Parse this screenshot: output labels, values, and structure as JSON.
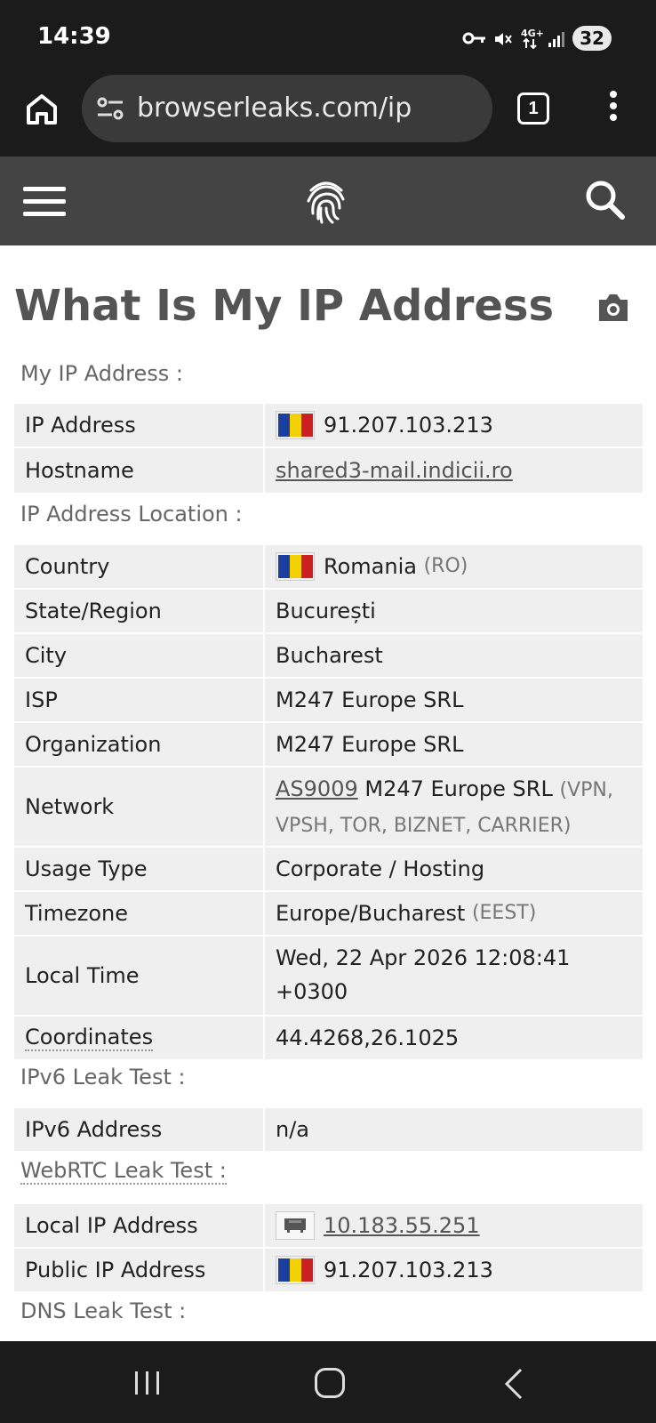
{
  "status_bar": {
    "time": "14:39",
    "battery": "32",
    "icons": [
      "vpn-key-icon",
      "mute-icon",
      "4g-icon",
      "signal-icon"
    ]
  },
  "browser": {
    "url": "browserleaks.com/ip",
    "tab_count": "1"
  },
  "page": {
    "title": "What Is My IP Address"
  },
  "sections": {
    "my_ip": {
      "label": "My IP Address :",
      "ip_key": "IP Address",
      "ip_value": "91.207.103.213",
      "host_key": "Hostname",
      "host_value": "shared3-mail.indicii.ro"
    },
    "location": {
      "label": "IP Address Location :",
      "country_key": "Country",
      "country_value": "Romania",
      "country_code": "(RO)",
      "state_key": "State/Region",
      "state_value": "București",
      "city_key": "City",
      "city_value": "Bucharest",
      "isp_key": "ISP",
      "isp_value": "M247 Europe SRL",
      "org_key": "Organization",
      "org_value": "M247 Europe SRL",
      "network_key": "Network",
      "network_asn": "AS9009",
      "network_name": "M247 Europe SRL",
      "network_tags_1": "(VPN,",
      "network_tags_2": "VPSH, TOR, BIZNET, CARRIER)",
      "usage_key": "Usage Type",
      "usage_value": "Corporate / Hosting",
      "tz_key": "Timezone",
      "tz_value": "Europe/Bucharest",
      "tz_abbr": "(EEST)",
      "time_key": "Local Time",
      "time_value_1": "Wed, 22 Apr 2026 12:08:41",
      "time_value_2": "+0300",
      "coords_key": "Coordinates",
      "coords_value": "44.4268,26.1025"
    },
    "ipv6": {
      "label": "IPv6 Leak Test :",
      "key": "IPv6 Address",
      "value": "n/a"
    },
    "webrtc": {
      "label": "WebRTC Leak Test :",
      "local_key": "Local IP Address",
      "local_value": "10.183.55.251",
      "public_key": "Public IP Address",
      "public_value": "91.207.103.213"
    },
    "dns": {
      "label": "DNS Leak Test :"
    }
  },
  "colors": {
    "flag_blue": "#1a3fa0",
    "flag_yellow": "#f5d000",
    "flag_red": "#cc1f1f",
    "row_bg": "#efefef",
    "header_bg": "#444444"
  }
}
